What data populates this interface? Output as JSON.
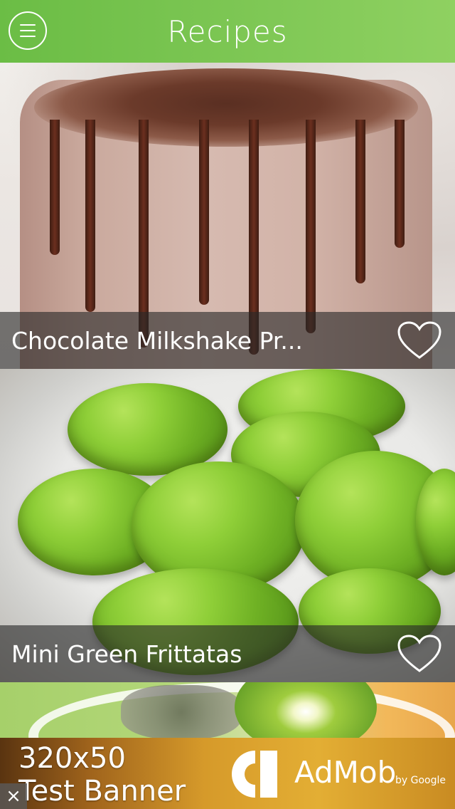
{
  "header": {
    "title": "Recipes",
    "menu_icon": "menu-icon",
    "color": "#7cc653"
  },
  "recipes": [
    {
      "name": "Chocolate Milkshake Pr...",
      "favorite_icon": "heart-outline-icon"
    },
    {
      "name": "Mini Green Frittatas",
      "favorite_icon": "heart-outline-icon"
    }
  ],
  "ad": {
    "size": "320x50",
    "label": "Test Banner",
    "brand": "AdMob",
    "by": "by Google",
    "close": "×"
  }
}
